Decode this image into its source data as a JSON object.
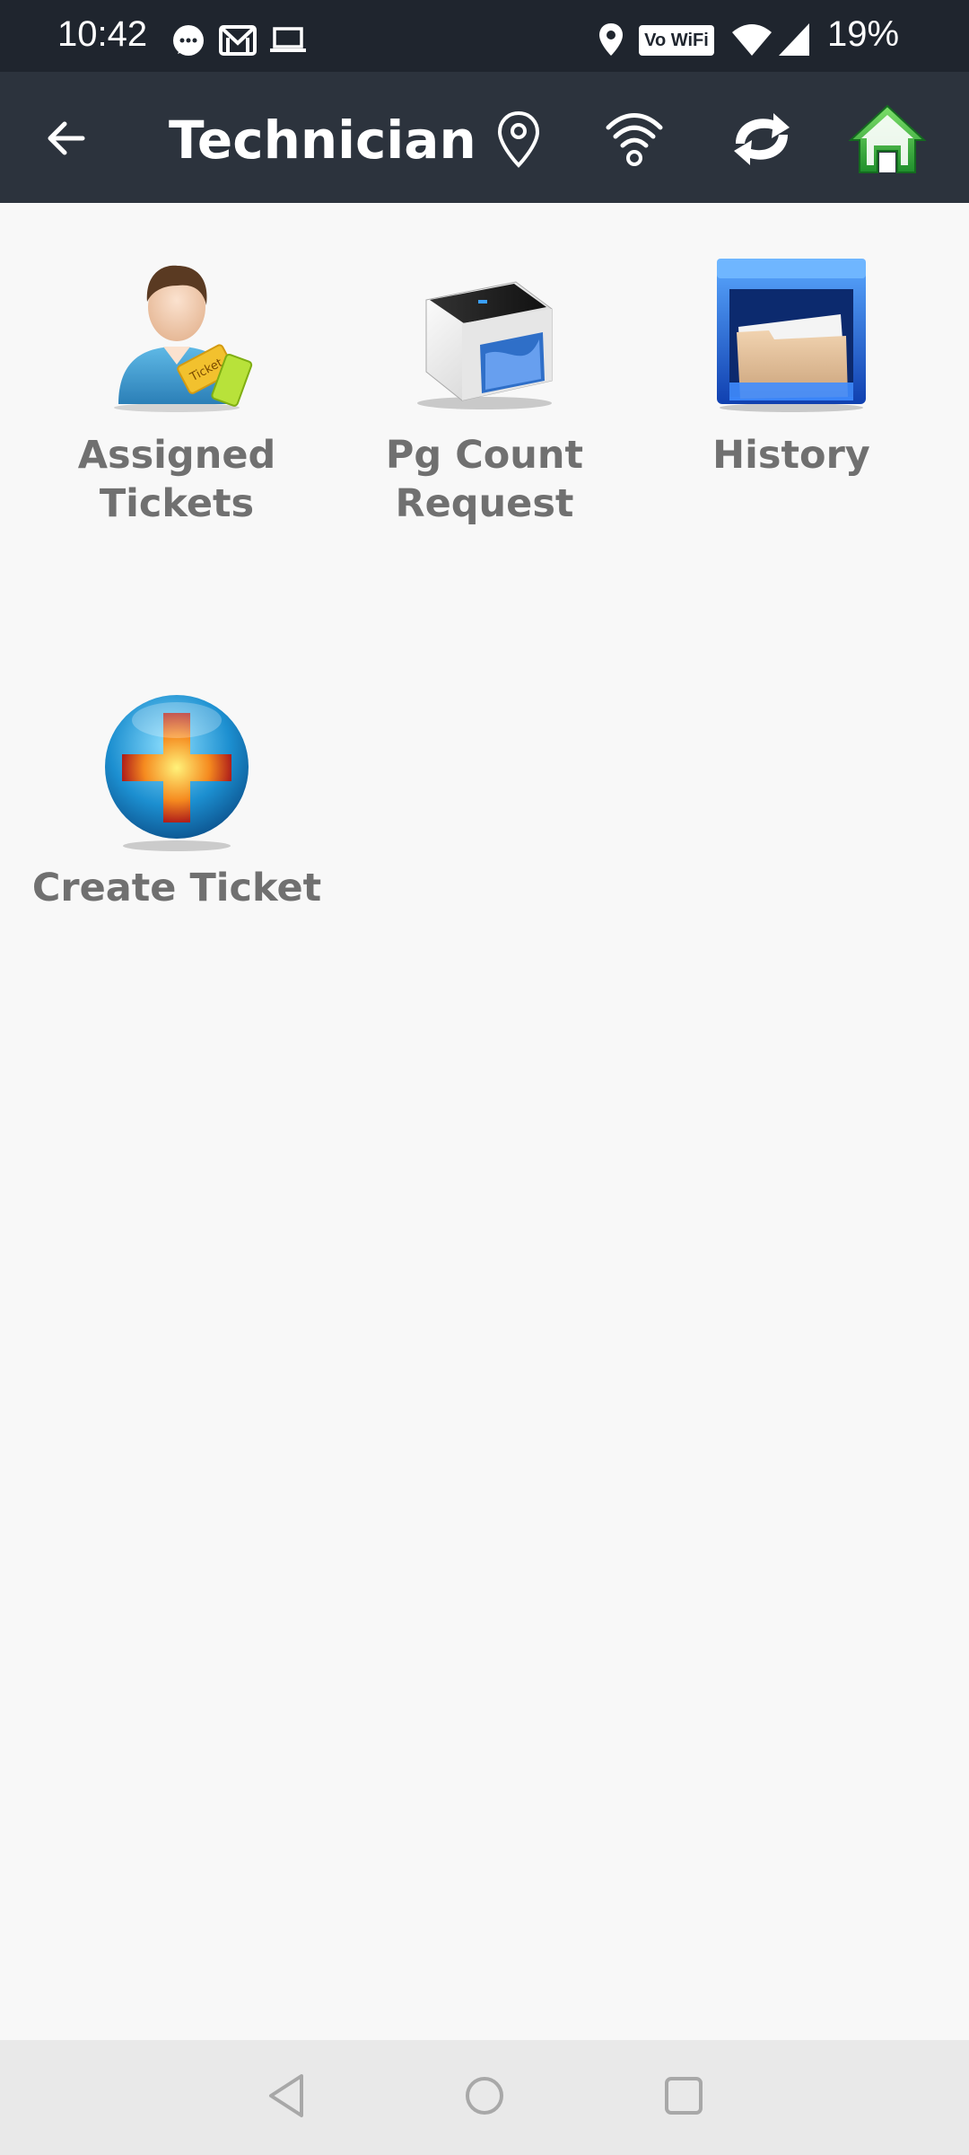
{
  "status_bar": {
    "time": "10:42",
    "wifi_badge": "Vo WiFi",
    "battery": "19%",
    "icons": [
      "chat-icon",
      "gmail-icon",
      "laptop-icon",
      "location-icon",
      "vowifi-icon",
      "wifi-icon",
      "signal-icon"
    ]
  },
  "app_bar": {
    "title": "Technician",
    "icons": [
      "back-arrow-icon",
      "location-pin-icon",
      "wifi-icon",
      "sync-icon",
      "home-icon"
    ],
    "home_color": "#39b54a"
  },
  "tiles": [
    {
      "label": "Assigned\nTickets",
      "icon": "assigned-tickets-icon"
    },
    {
      "label": "Pg Count\nRequest",
      "icon": "printer-icon"
    },
    {
      "label": "History",
      "icon": "history-folder-icon"
    },
    {
      "label": "Create Ticket",
      "icon": "create-ticket-plus-icon"
    }
  ],
  "nav_bar": {
    "buttons": [
      "back-nav-icon",
      "home-nav-icon",
      "recents-nav-icon"
    ]
  }
}
